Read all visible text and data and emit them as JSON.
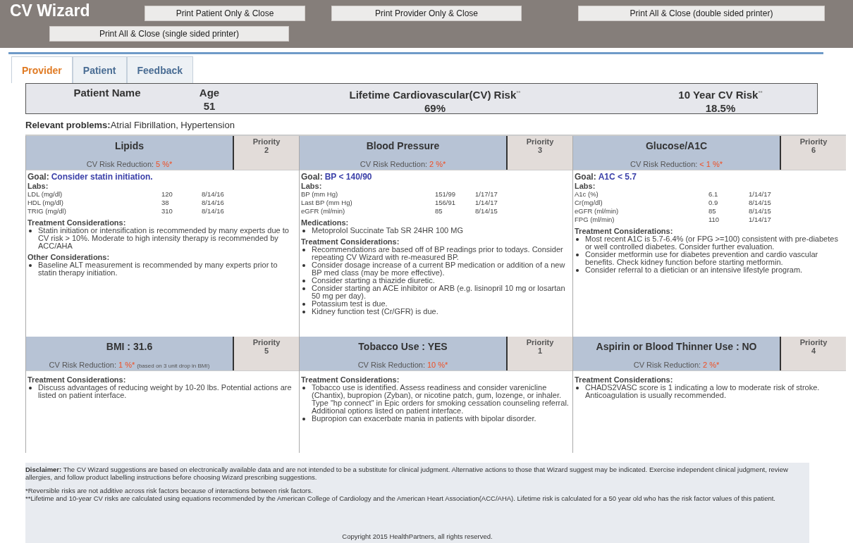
{
  "app_title": "CV Wizard",
  "print_buttons": [
    "Print Patient Only & Close",
    "Print Provider Only & Close",
    "Print All & Close (double sided printer)",
    "Print All & Close (single sided printer)"
  ],
  "tabs": [
    {
      "label": "Provider",
      "selected": true
    },
    {
      "label": "Patient",
      "selected": false
    },
    {
      "label": "Feedback",
      "selected": false
    }
  ],
  "summary": [
    {
      "header": "Patient Name"
    },
    {
      "header": "Age",
      "value": "51"
    },
    {
      "header": "Lifetime Cardiovascular(CV) Risk$^{**}$",
      "value": "69%"
    },
    {
      "header": "10 Year CV Risk$^{**}$",
      "value": "18.5%"
    }
  ],
  "relevant_problems": {
    "label": "Relevant problems:",
    "value": "Atrial Fibrillation, Hypertension"
  },
  "cards": [
    {
      "title": "Lipids",
      "priority_label": "Priority",
      "priority": "2",
      "reduction_label": "CV Risk Reduction:",
      "reduction": "5 %*",
      "goal_label": "Goal:",
      "goal": "Consider statin initiation.",
      "sections": [
        {
          "kind": "labs",
          "heading": "Labs:",
          "rows": [
            [
              "LDL (mg/dl)",
              "120",
              "8/14/16"
            ],
            [
              "HDL (mg/dl)",
              "38",
              "8/14/16"
            ],
            [
              "TRIG (mg/dl)",
              "310",
              "8/14/16"
            ]
          ]
        },
        {
          "kind": "bullets",
          "heading": "Treatment Considerations:",
          "items": [
            "Statin initiation or intensification is recommended by many experts due to CV risk > 10%. Moderate to high intensity therapy is recommended by ACC/AHA"
          ]
        },
        {
          "kind": "bullets",
          "heading": "Other Considerations:",
          "items": [
            "Baseline ALT measurement is recommended by many experts prior to statin therapy initiation."
          ]
        }
      ]
    },
    {
      "title": "Blood Pressure",
      "priority_label": "Priority",
      "priority": "3",
      "reduction_label": "CV Risk Reduction:",
      "reduction": "2 %*",
      "goal_label": "Goal:",
      "goal": "BP < 140/90",
      "sections": [
        {
          "kind": "labs",
          "heading": "Labs:",
          "rows": [
            [
              "BP (mm Hg)",
              "151/99",
              "1/17/17"
            ],
            [
              "Last BP (mm Hg)",
              "156/91",
              "1/14/17"
            ],
            [
              "eGFR (ml/min)",
              "85",
              "8/14/15"
            ]
          ]
        },
        {
          "kind": "bullets",
          "heading": "Medications:",
          "items": [
            "Metoprolol Succinate Tab SR 24HR 100 MG"
          ]
        },
        {
          "kind": "bullets",
          "heading": "Treatment Considerations:",
          "items": [
            "Recommendations are based off of BP readings prior to todays. Consider repeating CV Wizard with re-measured BP.",
            "Consider dosage increase of a current BP medication or addition of a new BP med class (may be more effective).",
            "Consider starting a thiazide diuretic.",
            "Consider starting an ACE inhibitor or ARB (e.g. lisinopril 10 mg or losartan 50 mg per day).",
            "Potassium test is due.",
            "Kidney function test (Cr/GFR) is due."
          ]
        }
      ]
    },
    {
      "title": "Glucose/A1C",
      "priority_label": "Priority",
      "priority": "6",
      "reduction_label": "CV Risk Reduction:",
      "reduction": "< 1 %*",
      "goal_label": "Goal:",
      "goal": "A1C < 5.7",
      "sections": [
        {
          "kind": "labs",
          "heading": "Labs:",
          "rows": [
            [
              "A1c (%)",
              "6.1",
              "1/14/17"
            ],
            [
              "Cr(mg/dl)",
              "0.9",
              "8/14/15"
            ],
            [
              "eGFR (ml/min)",
              "85",
              "8/14/15"
            ],
            [
              "FPG (ml/min)",
              "110",
              "1/14/17"
            ]
          ]
        },
        {
          "kind": "bullets",
          "heading": "Treatment Considerations:",
          "items": [
            "Most recent A1C is 5.7-6.4% (or FPG >=100) consistent with pre-diabetes or well controlled diabetes. Consider further evaluation.",
            "Consider metformin use for diabetes prevention and cardio vascular benefits. Check kidney function before starting metformin.",
            "Consider referral to a dietician or an intensive lifestyle program."
          ]
        }
      ]
    },
    {
      "title": "BMI : 31.6",
      "priority_label": "Priority",
      "priority": "5",
      "reduction_label": "CV Risk Reduction:",
      "reduction": "1 %*",
      "reduction_note": "(based on 3 unit drop in BMI)",
      "sections": [
        {
          "kind": "bullets",
          "heading": "Treatment Considerations:",
          "items": [
            "Discuss advantages of reducing weight by 10-20 lbs. Potential actions are listed on patient interface."
          ]
        }
      ]
    },
    {
      "title": "Tobacco Use : YES",
      "priority_label": "Priority",
      "priority": "1",
      "reduction_label": "CV Risk Reduction:",
      "reduction": "10 %*",
      "sections": [
        {
          "kind": "bullets",
          "heading": "Treatment Considerations:",
          "items": [
            "Tobacco use is identified. Assess readiness and consider varenicline (Chantix), bupropion (Zyban), or nicotine patch, gum, lozenge, or inhaler. Type \"hp connect\" in Epic orders for smoking cessation counseling referral. Additional options listed on patient interface.",
            "Bupropion can exacerbate mania in patients with bipolar disorder."
          ]
        }
      ]
    },
    {
      "title": "Aspirin or Blood Thinner Use : NO",
      "priority_label": "Priority",
      "priority": "4",
      "reduction_label": "CV Risk Reduction:",
      "reduction": "2 %*",
      "sections": [
        {
          "kind": "bullets",
          "heading": "Treatment Considerations:",
          "items": [
            "CHADS2VASC score is 1 indicating a low to moderate risk of stroke. Anticoagulation is usually recommended."
          ]
        }
      ]
    }
  ],
  "disclaimer": "**Disclaimer:**   The CV Wizard suggestions are based on electronically available data and are not intended to be a substitute for clinical judgment. Alternative actions to those that Wizard suggest may be indicated. Exercise independent clinical judgment, review allergies, and follow product labelling instructions before choosing Wizard prescribing suggestions.",
  "footnotes": [
    "*Reversible risks are not additive across risk factors because of interactions between risk factors.",
    "**Lifetime and 10-year CV risks are calculated using equations recommended by the American College of Cardiology and the American Heart Association(ACC/AHA). Lifetime risk is calculated for a 50 year old who has the risk factor values of this patient."
  ],
  "copyright": "Copyright 2015 HealthPartners, all rights reserved."
}
